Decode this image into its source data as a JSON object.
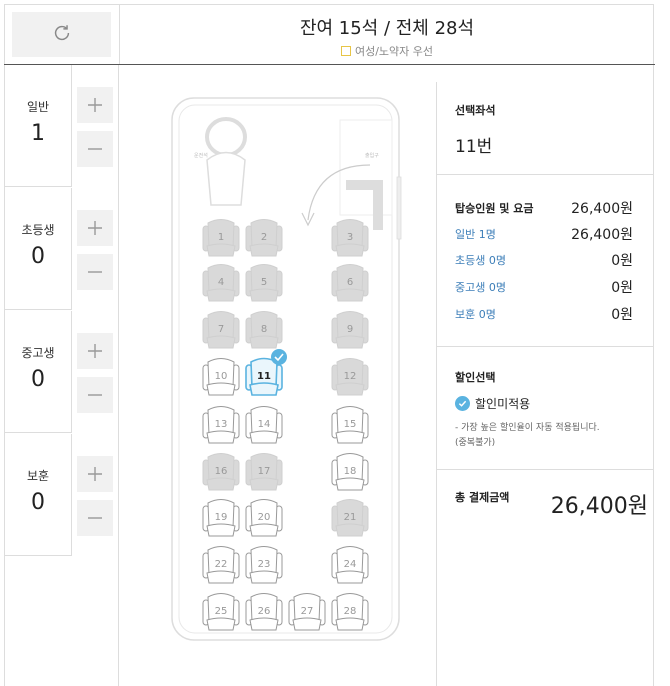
{
  "header": {
    "title": "잔여 15석 / 전체 28석",
    "legend": "여성/노약자 우선"
  },
  "passengers": [
    {
      "label": "일반",
      "count": "1"
    },
    {
      "label": "초등생",
      "count": "0"
    },
    {
      "label": "중고생",
      "count": "0"
    },
    {
      "label": "보훈",
      "count": "0"
    }
  ],
  "bus": {
    "labels": {
      "driver": "운전석",
      "door": "출입구"
    },
    "seats": [
      {
        "n": "1",
        "taken": true
      },
      {
        "n": "2",
        "taken": true
      },
      {
        "n": "3",
        "taken": true
      },
      {
        "n": "4",
        "taken": true
      },
      {
        "n": "5",
        "taken": true
      },
      {
        "n": "6",
        "taken": true
      },
      {
        "n": "7",
        "taken": true
      },
      {
        "n": "8",
        "taken": true
      },
      {
        "n": "9",
        "taken": true
      },
      {
        "n": "10",
        "taken": false
      },
      {
        "n": "11",
        "taken": false,
        "selected": true
      },
      {
        "n": "12",
        "taken": true
      },
      {
        "n": "13",
        "taken": false
      },
      {
        "n": "14",
        "taken": false
      },
      {
        "n": "15",
        "taken": false
      },
      {
        "n": "16",
        "taken": true
      },
      {
        "n": "17",
        "taken": true
      },
      {
        "n": "18",
        "taken": false
      },
      {
        "n": "19",
        "taken": false
      },
      {
        "n": "20",
        "taken": false
      },
      {
        "n": "21",
        "taken": true
      },
      {
        "n": "22",
        "taken": false
      },
      {
        "n": "23",
        "taken": false
      },
      {
        "n": "24",
        "taken": false
      },
      {
        "n": "25",
        "taken": false
      },
      {
        "n": "26",
        "taken": false
      },
      {
        "n": "27",
        "taken": false
      },
      {
        "n": "28",
        "taken": false
      }
    ]
  },
  "selection": {
    "title": "선택좌석",
    "seat": "11번"
  },
  "fare": {
    "title": "탑승인원 및 요금",
    "total_line": "26,400원",
    "rows": [
      {
        "label": "일반 1명",
        "value": "26,400원"
      },
      {
        "label": "초등생 0명",
        "value": "0원"
      },
      {
        "label": "중고생 0명",
        "value": "0원"
      },
      {
        "label": "보훈 0명",
        "value": "0원"
      }
    ]
  },
  "discount": {
    "title": "할인선택",
    "option": "할인미적용",
    "note1": "- 가장 높은 할인율이 자동 적용됩니다.",
    "note2": "(중복불가)"
  },
  "payment": {
    "label": "총 결제금액",
    "amount": "26,400원"
  },
  "colors": {
    "accent": "#5ab3e0",
    "taken_seat": "#d9d9d9",
    "link_text": "#3c7eb8",
    "legend_border": "#e7c547"
  }
}
